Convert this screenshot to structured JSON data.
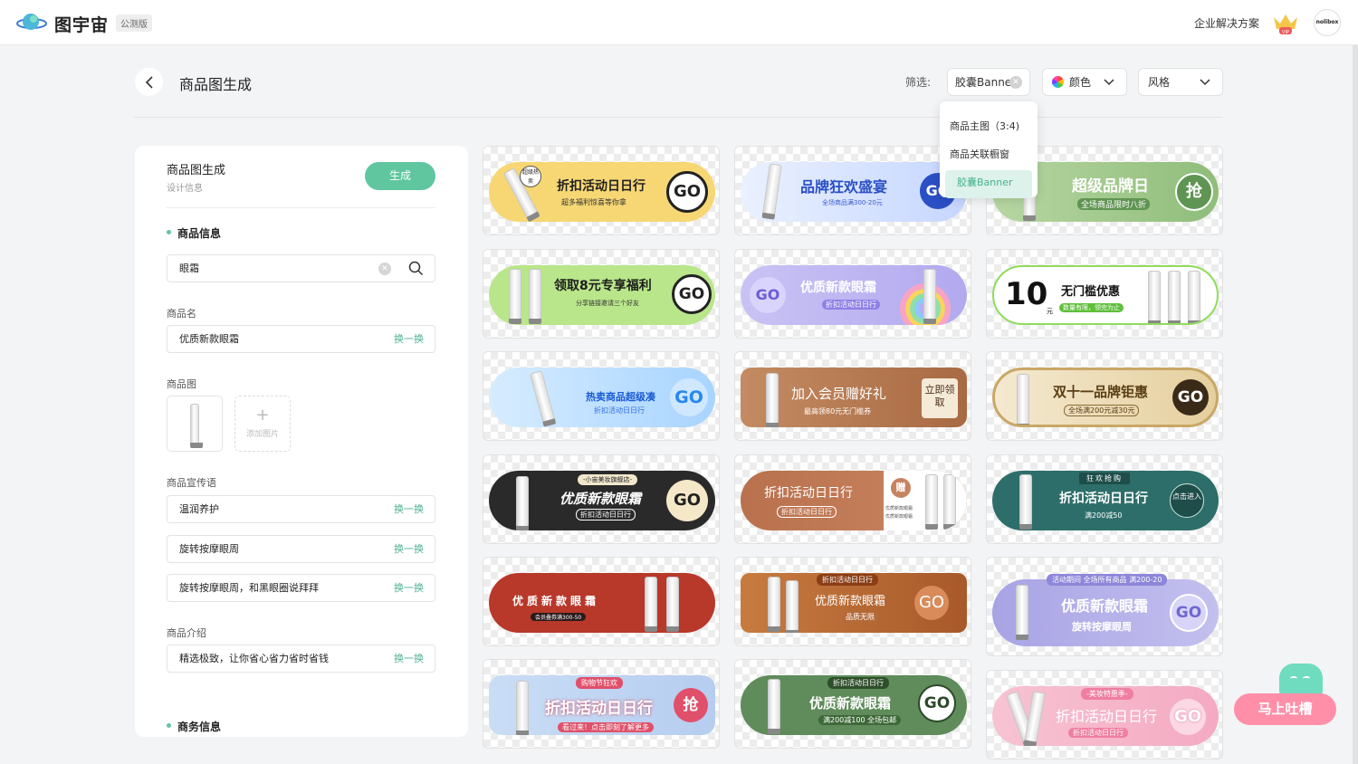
{
  "nav": {
    "brand": "图宇宙",
    "beta": "公测版",
    "enterprise": "企业解决方案",
    "vip": "VIP",
    "avatar_text": "nolibox"
  },
  "header": {
    "title": "商品图生成",
    "filter_label": "筛选:",
    "type_value": "胶囊Banner",
    "color_label": "颜色",
    "style_label": "风格"
  },
  "dropdown": {
    "items": [
      "商品主图（3:4)",
      "商品关联橱窗",
      "胶囊Banner"
    ]
  },
  "panel": {
    "title": "商品图生成",
    "subtitle": "设计信息",
    "generate": "生成",
    "section_product": "商品信息",
    "search_value": "眼霜",
    "name_label": "商品名",
    "name_value": "优质新款眼霜",
    "swap": "换一换",
    "image_label": "商品图",
    "add_image": "添加图片",
    "slogan_label": "商品宣传语",
    "slogans": [
      "温润养护",
      "旋转按摩眼周",
      "旋转按摩眼周，和黑眼圈说拜拜"
    ],
    "intro_label": "商品介绍",
    "intro_value": "精选极致，让你省心省力省时省钱",
    "section_business": "商务信息"
  },
  "cards": [
    {
      "title": "折扣活动日日行",
      "sub": "超多福利惊喜等你拿",
      "go": "GO",
      "tag": "超级热卖"
    },
    {
      "title": "品牌狂欢盛宴",
      "sub": "全场商品满300-20元",
      "go": "GO"
    },
    {
      "title": "超级品牌日",
      "sub": "全场商品限时八折",
      "go": "抢"
    },
    {
      "title": "领取8元专享福利",
      "sub": "分享链接邀请三个好友",
      "go": "GO"
    },
    {
      "title": "优质新款眼霜",
      "sub": "折扣活动日日行",
      "go": "GO"
    },
    {
      "big": "10",
      "unit": "元",
      "title": "无门槛优惠",
      "sub": "数量有限，领完为止"
    },
    {
      "title": "热卖商品超级凑",
      "sub": "折扣活动日日行",
      "go": "GO"
    },
    {
      "title": "加入会员赠好礼",
      "sub": "最高领80元无门槛券",
      "go": "立即领取"
    },
    {
      "title": "双十一品牌钜惠",
      "sub": "全场满200元减30元",
      "go": "GO"
    },
    {
      "top": "-小宙美妆旗舰店-",
      "title": "优质新款眼霜",
      "sub": "折扣活动日日行",
      "go": "GO"
    },
    {
      "title": "折扣活动日日行",
      "sub": "折扣活动日日行",
      "go": "赠",
      "tag1": "优质新款眼霜",
      "tag2": "优质新款眼霜"
    },
    {
      "top": "狂欢抢购",
      "title": "折扣活动日日行",
      "sub": "满200减50",
      "go": "点击进入"
    },
    {
      "title": "优质新款眼霜",
      "sub": "会员叠券满300-50"
    },
    {
      "top": "折扣活动日日行",
      "title": "优质新款眼霜",
      "sub": "品质无限",
      "go": "GO"
    },
    {
      "top": "活动期间 全场所有商品 满200-20",
      "title": "优质新款眼霜",
      "sub": "旋转按摩眼周",
      "go": "GO"
    },
    {
      "top": "购物节狂欢",
      "title": "折扣活动日日行",
      "sub": "看过来！点击即刻了解更多",
      "go": "抢"
    },
    {
      "top": "折扣活动日日行",
      "title": "优质新款眼霜",
      "sub": "满200减100 全场包邮",
      "go": "GO"
    },
    {
      "top": "-美妆特惠季-",
      "title": "折扣活动日日行",
      "sub": "折扣活动日日行",
      "go": "GO"
    }
  ],
  "feedback": {
    "label": "马上吐槽"
  },
  "colors": {
    "accent": "#5fc6a0",
    "accent_text": "#4fb38f"
  }
}
